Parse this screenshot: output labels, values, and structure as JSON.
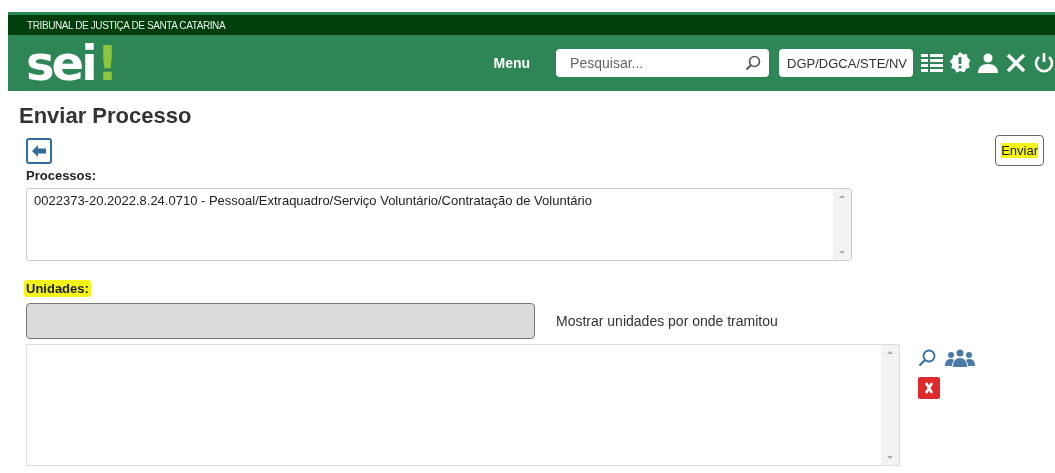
{
  "header": {
    "organization": "TRIBUNAL DE JUSTIÇA DE SANTA CATARINA",
    "logo": {
      "text": "sei",
      "mark": "!"
    },
    "menu": "Menu",
    "search": {
      "placeholder": "Pesquisar..."
    },
    "unit": "DGP/DGCA/STE/NV"
  },
  "page": {
    "title": "Enviar Processo",
    "send_button": {
      "label": "Enviar",
      "highlighted": true
    },
    "processes": {
      "label": "Processos:",
      "items": [
        "0022373-20.2022.8.24.0710 - Pessoal/Extraquadro/Serviço Voluntário/Contratação de Voluntário"
      ]
    },
    "units": {
      "label": "Unidades:",
      "highlighted": true,
      "show_history": "Mostrar unidades por onde tramitou"
    }
  }
}
